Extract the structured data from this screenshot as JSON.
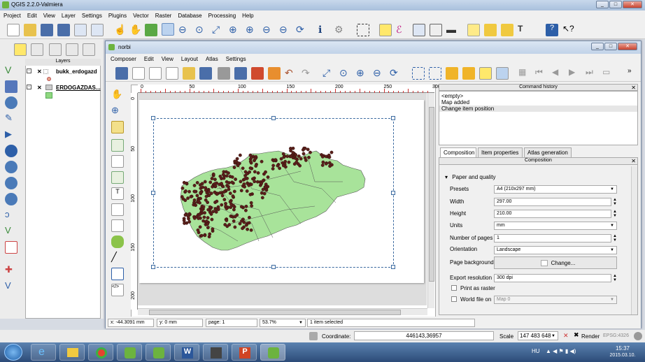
{
  "app_title": "QGIS 2.2.0-Valmiera",
  "main_menu": [
    "Project",
    "Edit",
    "View",
    "Layer",
    "Settings",
    "Plugins",
    "Vector",
    "Raster",
    "Database",
    "Processing",
    "Help"
  ],
  "layers": {
    "header": "Layers",
    "items": [
      {
        "name": "bukk_erdogazd"
      },
      {
        "name": "ERDOGAZDAS..."
      }
    ]
  },
  "composer": {
    "title": "norbi",
    "menu": [
      "Composer",
      "Edit",
      "View",
      "Layout",
      "Atlas",
      "Settings"
    ],
    "ruler_x": [
      "0",
      "50",
      "100",
      "150",
      "200",
      "250",
      "300"
    ],
    "ruler_y": [
      "0",
      "50",
      "100",
      "150",
      "200"
    ],
    "command_history": {
      "title": "Command history",
      "items": [
        "<empty>",
        "Map added",
        "Change item position"
      ]
    },
    "tabs": [
      "Composition",
      "Item properties",
      "Atlas generation"
    ],
    "panel_title": "Composition",
    "section": "Paper and quality",
    "fields": {
      "presets_label": "Presets",
      "presets": "A4 (210x297 mm)",
      "width_label": "Width",
      "width": "297.00",
      "height_label": "Height",
      "height": "210.00",
      "units_label": "Units",
      "units": "mm",
      "pages_label": "Number of pages",
      "pages": "1",
      "orientation_label": "Orientation",
      "orientation": "Landscape",
      "bg_label": "Page background",
      "bg_button": "Change...",
      "export_label": "Export resolution",
      "export": "300 dpi",
      "print_raster": "Print as raster",
      "world_file": "World file on",
      "world_map": "Map 0"
    },
    "status": {
      "x": "x: -44.3091 mm",
      "y": "y: 0 mm",
      "page": "page: 1",
      "zoom": "53.7%",
      "selection": "1 item selected"
    }
  },
  "main_status": {
    "coord_label": "Coordinate:",
    "coord": "446143,36957",
    "scale_label": "Scale",
    "scale": "147 483 648",
    "render": "Render",
    "epsg": "EPSG:4326"
  },
  "taskbar": {
    "lang": "HU",
    "time": "15:37",
    "date": "2015.03.10."
  },
  "colors": {
    "map_fill": "#a8e39a",
    "points": "#5a1f1a",
    "accent": "#3b6aa0"
  }
}
